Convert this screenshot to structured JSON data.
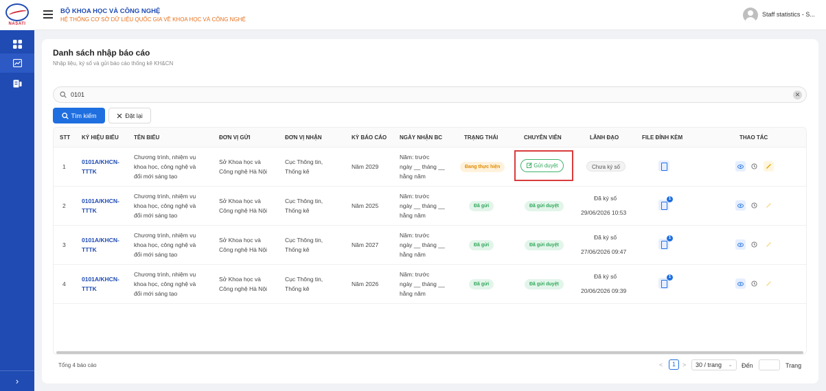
{
  "brand": {
    "logo_text": "NASATI"
  },
  "header": {
    "org_title": "BỘ KHOA HỌC VÀ CÔNG NGHỆ",
    "org_subtitle": "HỆ THỐNG CƠ SỞ DỮ LIỆU QUỐC GIA VỀ KHOA HỌC VÀ CÔNG NGHỆ",
    "user_name": "Staff statistics - S..."
  },
  "sidebar": {
    "items": [
      {
        "icon": "dashboard-icon",
        "active": false
      },
      {
        "icon": "chart-icon",
        "active": true
      },
      {
        "icon": "report-icon",
        "active": false
      }
    ],
    "collapse_glyph": "›"
  },
  "page": {
    "title": "Danh sách nhập báo cáo",
    "subtitle": "Nhập liệu, ký số và gửi báo cáo thống kê KH&CN"
  },
  "search": {
    "value": "0101",
    "clear_glyph": "✕"
  },
  "buttons": {
    "search_label": "Tìm kiếm",
    "reset_label": "Đặt lại"
  },
  "table": {
    "headers": {
      "stt": "STT",
      "code": "KÝ HIỆU BIỂU",
      "name": "TÊN BIỂU",
      "sender": "ĐƠN VỊ GỬI",
      "receiver": "ĐƠN VỊ NHẬN",
      "period": "KỲ BÁO CÁO",
      "received": "NGÀY NHẬN BC",
      "status": "TRẠNG THÁI",
      "specialist": "CHUYÊN VIÊN",
      "leader": "LÃNH ĐẠO",
      "files": "FILE ĐÍNH KÈM",
      "actions": "THAO TÁC"
    },
    "rows": [
      {
        "stt": "1",
        "code_line1": "0101A/KHCN-",
        "code_line2": "TTTK",
        "name_l1": "Chương trình, nhiệm vụ",
        "name_l2": "khoa học, công nghệ và",
        "name_l3": "đổi mới sáng tạo",
        "sender_l1": "Sở Khoa học và",
        "sender_l2": "Công nghệ Hà Nội",
        "receiver_l1": "Cục Thông tin,",
        "receiver_l2": "Thống kê",
        "period": "Năm 2029",
        "recv_l1": "Năm: trước",
        "recv_l2": "ngày __ tháng __",
        "recv_l3": "hằng năm",
        "status": "Đang thực hiện",
        "specialist": "Gửi duyệt",
        "leader": "Chưa ký số",
        "leader_date": "",
        "file_count": ""
      },
      {
        "stt": "2",
        "code_line1": "0101A/KHCN-",
        "code_line2": "TTTK",
        "name_l1": "Chương trình, nhiệm vụ",
        "name_l2": "khoa học, công nghệ và",
        "name_l3": "đổi mới sáng tạo",
        "sender_l1": "Sở Khoa học và",
        "sender_l2": "Công nghệ Hà Nội",
        "receiver_l1": "Cục Thông tin,",
        "receiver_l2": "Thống kê",
        "period": "Năm 2025",
        "recv_l1": "Năm: trước",
        "recv_l2": "ngày __ tháng __",
        "recv_l3": "hằng năm",
        "status": "Đã gửi",
        "specialist": "Đã gửi duyệt",
        "leader": "Đã ký số",
        "leader_date": "29/06/2026 10:53",
        "file_count": "1"
      },
      {
        "stt": "3",
        "code_line1": "0101A/KHCN-",
        "code_line2": "TTTK",
        "name_l1": "Chương trình, nhiệm vụ",
        "name_l2": "khoa học, công nghệ và",
        "name_l3": "đổi mới sáng tạo",
        "sender_l1": "Sở Khoa học và",
        "sender_l2": "Công nghệ Hà Nội",
        "receiver_l1": "Cục Thông tin,",
        "receiver_l2": "Thống kê",
        "period": "Năm 2027",
        "recv_l1": "Năm: trước",
        "recv_l2": "ngày __ tháng __",
        "recv_l3": "hằng năm",
        "status": "Đã gửi",
        "specialist": "Đã gửi duyệt",
        "leader": "Đã ký số",
        "leader_date": "27/06/2026 09:47",
        "file_count": "1"
      },
      {
        "stt": "4",
        "code_line1": "0101A/KHCN-",
        "code_line2": "TTTK",
        "name_l1": "Chương trình, nhiệm vụ",
        "name_l2": "khoa học, công nghệ và",
        "name_l3": "đổi mới sáng tạo",
        "sender_l1": "Sở Khoa học và",
        "sender_l2": "Công nghệ Hà Nội",
        "receiver_l1": "Cục Thông tin,",
        "receiver_l2": "Thống kê",
        "period": "Năm 2026",
        "recv_l1": "Năm: trước",
        "recv_l2": "ngày __ tháng __",
        "recv_l3": "hằng năm",
        "status": "Đã gửi",
        "specialist": "Đã gửi duyệt",
        "leader": "Đã ký số",
        "leader_date": "20/06/2026 09:39",
        "file_count": "1"
      }
    ]
  },
  "footer": {
    "total": "Tổng 4 báo cáo",
    "prev_glyph": "<",
    "next_glyph": ">",
    "current_page": "1",
    "page_size": "30 / trang",
    "goto_label": "Đến",
    "goto_suffix": "Trang"
  },
  "colors": {
    "sidebar": "#1f4bb3",
    "primary": "#1f6fe0",
    "status_in_progress": "#e08a00",
    "status_sent": "#2fa85a",
    "highlight": "#d93a3a"
  }
}
